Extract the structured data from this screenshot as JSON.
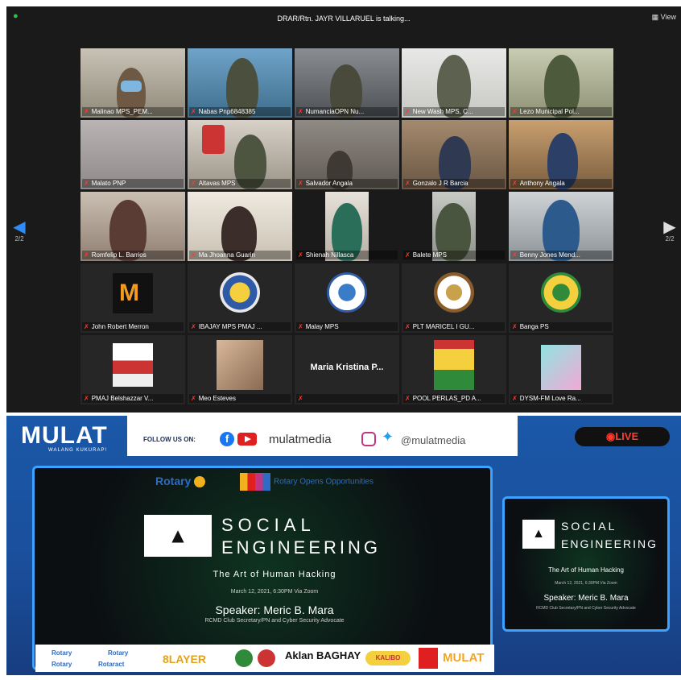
{
  "zoom": {
    "speaking": "DRAR/Rtn. JAYR VILLARUEL is talking...",
    "view_label": "View",
    "page_left": "2/2",
    "page_right": "2/2",
    "participants": [
      "Malinao MPS_PEM...",
      "Nabas Pnp6848385",
      "NumanciaOPN Nu...",
      "New Wash MPS, C...",
      "Lezo Municipal Pol...",
      "Malato PNP",
      "Altavas MPS",
      "Salvador Angala",
      "Gonzalo J R Barcia",
      "Anthony Angala",
      "Romfelip L. Barrios",
      "Ma Jhoanna Guarin",
      "Shienah Nillasca",
      "Balete MPS",
      "Benny Jones Mend...",
      "John Robert Merron",
      "IBAJAY MPS PMAJ ...",
      "Malay MPS",
      "PLT MARICEL I GU...",
      "Banga PS",
      "PMAJ Belshazzar V...",
      "Meo Esteves",
      "Maria Kristina P...",
      "POOL PERLAS_PD A...",
      "DYSM-FM Love Ra..."
    ],
    "big_name": "Maria Kristina P..."
  },
  "stream": {
    "brand": "MULAT",
    "brand_sub": "WALANG KUKURAP!",
    "follow": "FOLLOW US ON:",
    "handle_1": "mulatmedia",
    "handle_2": "@mulatmedia",
    "live": "LIVE",
    "slide": {
      "rotary": "Rotary",
      "roo": "Rotary Opens Opportunities",
      "title_1": "SOCIAL",
      "title_2": "ENGINEERING",
      "subtitle": "The Art of Human Hacking",
      "date": "March 12, 2021, 6:30PM Via Zoom",
      "speaker": "Speaker: Meric B. Mara",
      "role": "RCMD Club Secretary/PN and Cyber Security Advocate"
    },
    "sponsors": [
      "Rotary",
      "Rotary",
      "Rotary",
      "Rotaract",
      "8LAYER",
      "Aklan BAGHAY",
      "KALIBO",
      "MULAT"
    ]
  },
  "colors": {
    "zoom_bg": "#1a1a1a",
    "stream_blue": "#1b58a8",
    "accent_blue": "#3da2ff",
    "live_red": "#ff3b30"
  }
}
